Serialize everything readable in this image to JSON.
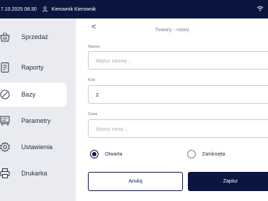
{
  "statusbar": {
    "datetime": "7.10.2025 08:30",
    "user": "Kierownik Kierownik"
  },
  "sidebar": {
    "items": [
      {
        "label": "Sprzedaż",
        "icon": "basket-icon",
        "active": false
      },
      {
        "label": "Raporty",
        "icon": "report-icon",
        "active": false
      },
      {
        "label": "Bazy",
        "icon": "database-icon",
        "active": true
      },
      {
        "label": "Parametry",
        "icon": "parameters-icon",
        "active": false
      },
      {
        "label": "Ustawienia",
        "icon": "gear-icon",
        "active": false
      },
      {
        "label": "Drukarka",
        "icon": "printer-icon",
        "active": false
      }
    ]
  },
  "header": {
    "back": "<",
    "title": "Towary - nowy"
  },
  "form": {
    "name": {
      "label": "Nazwa",
      "placeholder": "Wpisz nazwę..."
    },
    "code": {
      "label": "Kod",
      "value": "2"
    },
    "price": {
      "label": "Cena",
      "placeholder": "Wpisz cenę..."
    },
    "radio_open": {
      "label": "Otwarta",
      "selected": true
    },
    "radio_closed": {
      "label": "Zamknięta",
      "selected": false
    }
  },
  "buttons": {
    "cancel": "Anuluj",
    "save": "Zapisz"
  },
  "colors": {
    "primary": "#0b1640",
    "background": "#e9ebf0"
  }
}
